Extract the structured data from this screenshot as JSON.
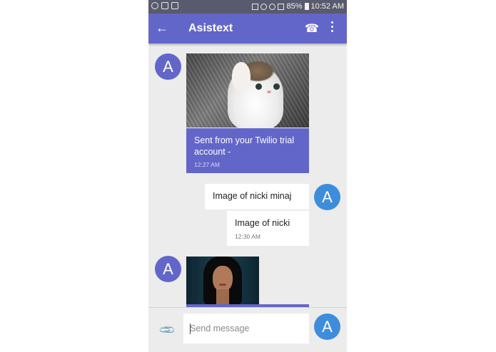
{
  "status_bar": {
    "battery": "85%",
    "time": "10:52 AM"
  },
  "app_bar": {
    "back_icon": "arrow-left-icon",
    "title": "Asistext",
    "call_icon": "phone-icon",
    "menu_icon": "more-vert-icon"
  },
  "messages": [
    {
      "direction": "in",
      "avatar": "A",
      "image": "kitten-photo"
    },
    {
      "direction": "in",
      "text": "Sent from your Twilio trial account -",
      "time": "12:27 AM"
    },
    {
      "direction": "out",
      "avatar": "A",
      "text": "Image of nicki minaj"
    },
    {
      "direction": "out",
      "text": "Image of nicki",
      "time": "12:30 AM"
    },
    {
      "direction": "in",
      "avatar": "A",
      "image": "nicki-photo"
    }
  ],
  "composer": {
    "attach_icon": "paperclip-icon",
    "placeholder": "Send message",
    "avatar": "A"
  },
  "colors": {
    "primary": "#6366c9",
    "status_bar": "#5a5a6e",
    "outgoing_avatar": "#3e8ddb",
    "background": "#ececec"
  }
}
